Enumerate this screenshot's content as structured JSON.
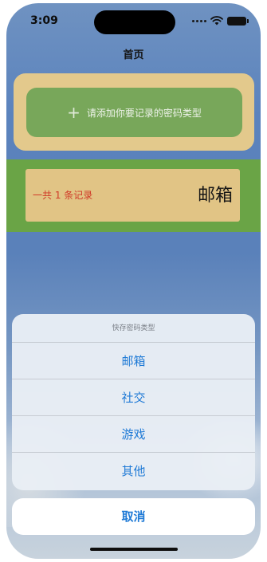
{
  "status": {
    "time": "3:09"
  },
  "nav": {
    "title": "首页"
  },
  "add_card": {
    "label": "请添加你要记录的密码类型",
    "icon": "plus-icon"
  },
  "record": {
    "count_text": "一共 1 条记录",
    "type_label": "邮箱"
  },
  "action_sheet": {
    "title": "快存密码类型",
    "options": [
      "邮箱",
      "社交",
      "游戏",
      "其他"
    ],
    "cancel": "取消"
  },
  "colors": {
    "add_outer": "#e3c98c",
    "add_inner": "#78a75a",
    "record_band": "#6aa446",
    "record_card": "#e1c485",
    "record_count": "#d03a28",
    "accent": "#1f7ad6"
  }
}
